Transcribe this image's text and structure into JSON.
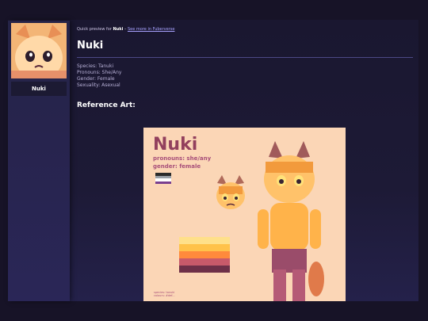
{
  "sidebar": {
    "profile_name": "Nuki"
  },
  "header": {
    "preview_prefix": "Quick preview for",
    "preview_name": "Nuki",
    "preview_sep": "–",
    "see_more_label": "See more in Fuberverse"
  },
  "main": {
    "title": "Nuki",
    "info": [
      "Species: Tanuki",
      "Pronouns: She/Any",
      "Gender: Female",
      "Sexuality: Asexual"
    ],
    "reference_heading": "Reference Art:"
  },
  "reference_art": {
    "name": "Nuki",
    "pronouns": "pronouns: she/any",
    "gender": "gender: female",
    "footer_line1": "species: tanuki",
    "footer_line2": "colours: #def...",
    "flag_colors": [
      "#2b2b2b",
      "#9aa0a8",
      "#ffffff",
      "#7a3f8f"
    ],
    "palette_colors": [
      "#ffe08a",
      "#ffc24a",
      "#ff8a3c",
      "#c85a6a",
      "#6e3048"
    ]
  }
}
